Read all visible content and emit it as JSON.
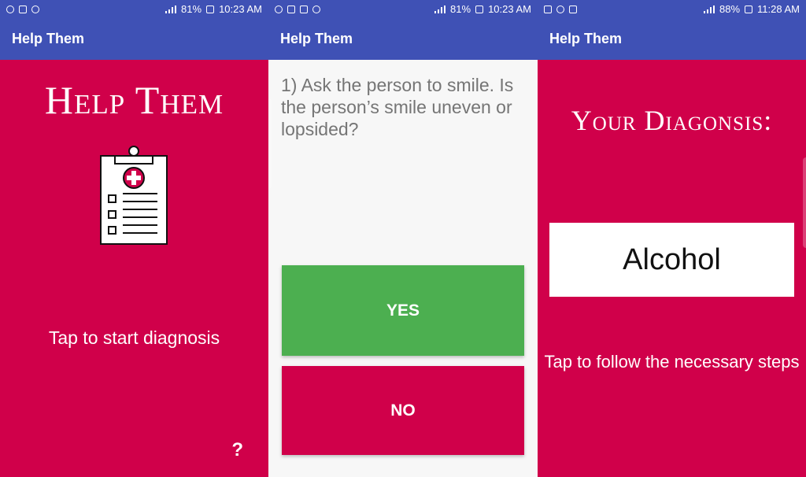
{
  "screens": [
    {
      "status": {
        "time": "10:23 AM",
        "battery": "81%"
      },
      "appbar": {
        "title": "Help Them"
      },
      "main": {
        "title": "Help Them",
        "tap_label": "Tap to start diagnosis",
        "help_label": "?"
      }
    },
    {
      "status": {
        "time": "10:23 AM",
        "battery": "81%"
      },
      "appbar": {
        "title": "Help Them"
      },
      "main": {
        "question_number": "1)",
        "question": "Ask the person to smile. Is the person’s smile uneven or lopsided?",
        "yes_label": "YES",
        "no_label": "NO"
      }
    },
    {
      "status": {
        "time": "11:28 AM",
        "battery": "88%"
      },
      "appbar": {
        "title": "Help Them"
      },
      "main": {
        "title": "Your Diagonsis:",
        "result": "Alcohol",
        "tap_label": "Tap to follow the necessary steps"
      }
    }
  ],
  "colors": {
    "primary": "#3f51b5",
    "crimson": "#d0004a",
    "green": "#4caf50",
    "light": "#f7f7f7"
  }
}
